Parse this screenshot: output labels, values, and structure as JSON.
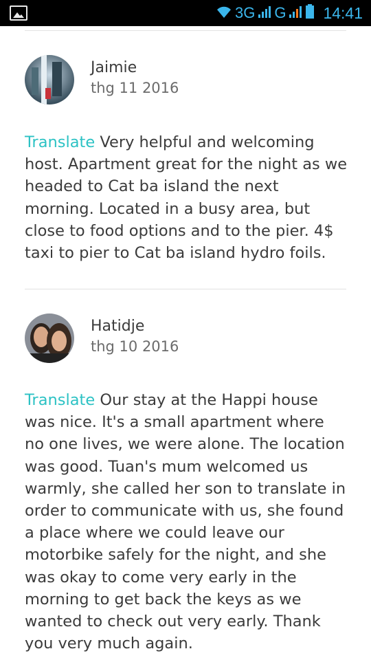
{
  "status_bar": {
    "network_1": "3G",
    "network_2": "G",
    "time": "14:41"
  },
  "reviews": [
    {
      "name": "Jaimie",
      "date": "thg 11 2016",
      "translate_label": "Translate",
      "text": "Very helpful and welcoming host. Apartment great for the night as we headed to Cat ba island the next morning. Located in a busy area, but close to food options and to the pier. 4$ taxi to pier to Cat ba island hydro foils."
    },
    {
      "name": "Hatidje",
      "date": "thg 10 2016",
      "translate_label": "Translate",
      "text": "Our stay at the Happi house was nice. It's a small apartment where no one lives, we were alone. The location was good. Tuan's mum welcomed us warmly, she called her son to translate in order to communicate with us, she found a place where we could leave our motorbike safely for the night, and she was okay to come very early in the morning to get back the keys as we wanted to check out very early. Thank you very much again."
    }
  ]
}
